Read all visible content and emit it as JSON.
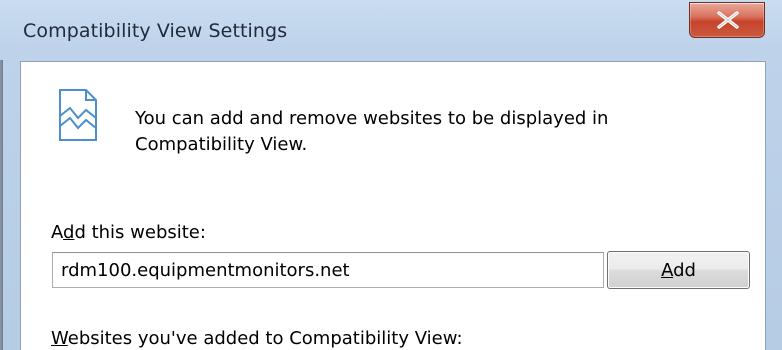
{
  "window": {
    "title": "Compatibility View Settings",
    "close_glyph": "x-icon"
  },
  "info": {
    "icon": "compatibility-view-broken-page-icon",
    "text": "You can add and remove websites to be displayed in Compatibility View."
  },
  "add_site": {
    "label_prefix": "A",
    "label_accel": "d",
    "label_suffix": "d this website:",
    "value": "rdm100.equipmentmonitors.net",
    "button_accel": "A",
    "button_rest": "dd"
  },
  "added_list": {
    "label_accel": "W",
    "label_rest": "ebsites you've added to Compatibility View:"
  },
  "colors": {
    "titlebar": "#bed3ea",
    "close_button": "#c7432b",
    "client_background": "#ffffff"
  }
}
